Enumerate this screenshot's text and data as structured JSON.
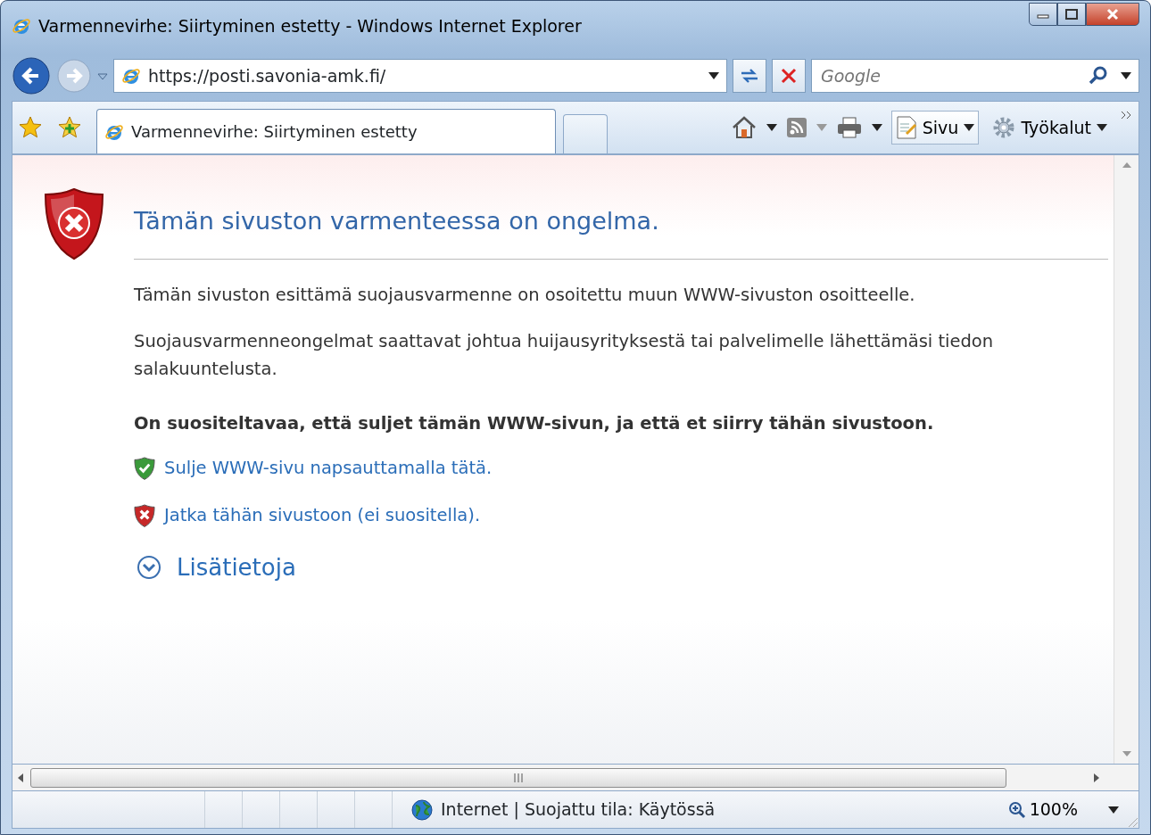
{
  "window": {
    "title": "Varmennevirhe: Siirtyminen estetty - Windows Internet Explorer"
  },
  "address_bar": {
    "value": "https://posti.savonia-amk.fi/"
  },
  "search": {
    "placeholder": "Google"
  },
  "tabs": [
    {
      "label": "Varmennevirhe: Siirtyminen estetty",
      "selected": true
    }
  ],
  "command_bar": [
    {
      "label": "Sivu",
      "kind": "page"
    },
    {
      "label": "Työkalut",
      "kind": "tools"
    }
  ],
  "page": {
    "heading": "Tämän sivuston varmenteessa on ongelma.",
    "paragraphs": [
      "Tämän sivuston esittämä suojausvarmenne on osoitettu muun WWW-sivuston osoitteelle.",
      "Suojausvarmenneongelmat saattavat johtua huijausyrityksestä tai palvelimelle lähettämäsi tiedon salakuuntelusta."
    ],
    "recommendation": "On suositeltavaa, että suljet tämän WWW-sivun, ja että et siirry tähän sivustoon.",
    "links": [
      {
        "label": "Sulje WWW-sivu napsauttamalla tätä.",
        "kind": "safe"
      },
      {
        "label": "Jatka tähän sivustoon (ei suositella).",
        "kind": "unsafe"
      }
    ],
    "more_info": {
      "label": "Lisätietoja",
      "expanded": false
    }
  },
  "status_bar": {
    "zone": "Internet | Suojattu tila: Käytössä",
    "zoom": "100%"
  }
}
